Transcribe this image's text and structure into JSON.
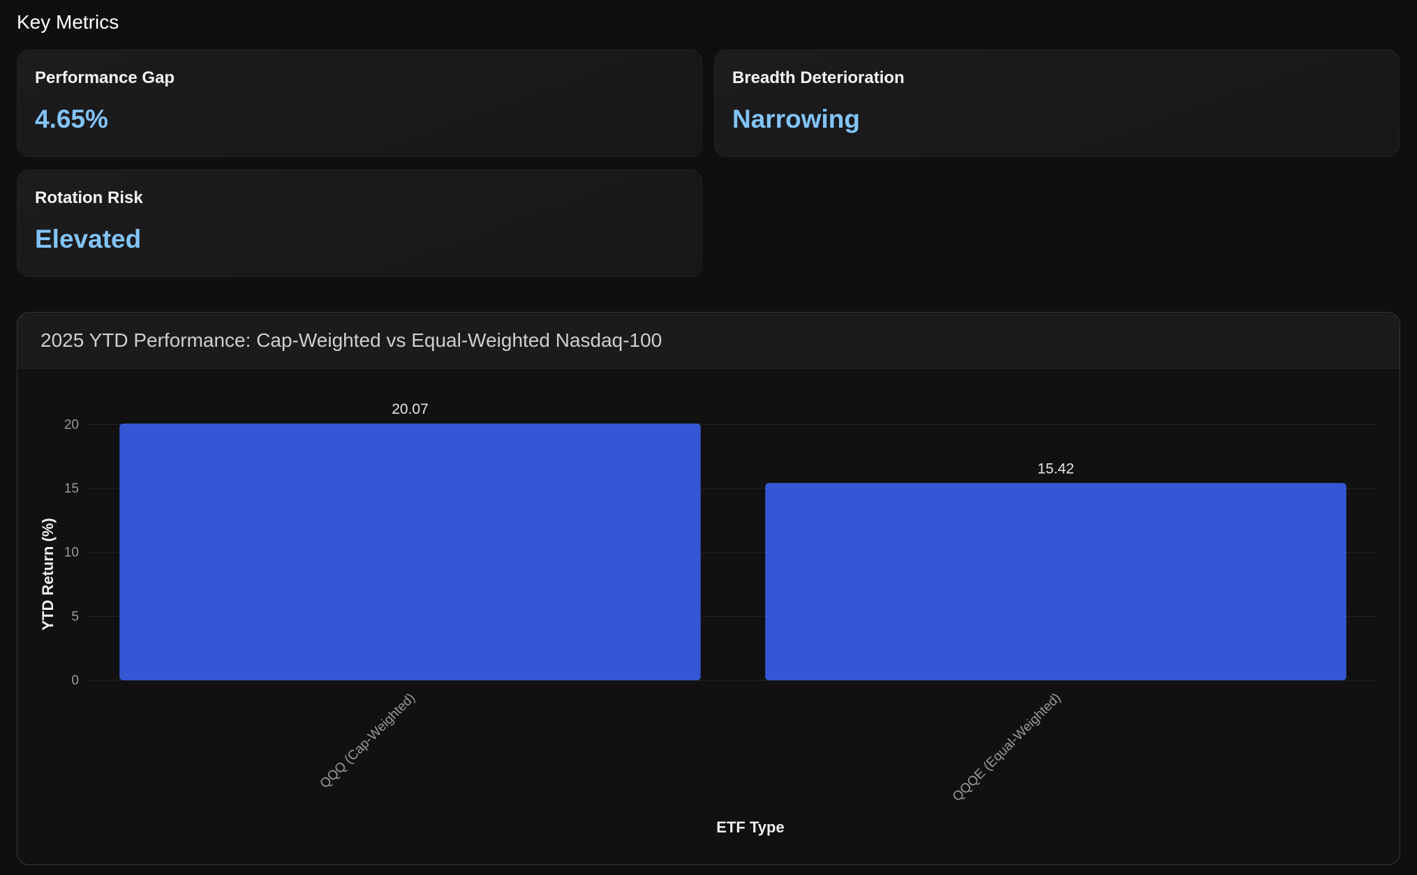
{
  "key_metrics": {
    "title": "Key Metrics",
    "cards": [
      {
        "label": "Performance Gap",
        "value": "4.65%"
      },
      {
        "label": "Breadth Deterioration",
        "value": "Narrowing"
      },
      {
        "label": "Rotation Risk",
        "value": "Elevated"
      }
    ]
  },
  "colors": {
    "accent_value": "#82c4f8",
    "bar": "#3457d5",
    "background": "#0f0f0f"
  },
  "chart_data": {
    "type": "bar",
    "title": "2025 YTD Performance: Cap-Weighted vs Equal-Weighted Nasdaq-100",
    "categories": [
      "QQQ (Cap-Weighted)",
      "QQQE (Equal-Weighted)"
    ],
    "values": [
      20.07,
      15.42
    ],
    "value_labels": [
      "20.07",
      "15.42"
    ],
    "xlabel": "ETF Type",
    "ylabel": "YTD Return (%)",
    "ylim": [
      0,
      20.07
    ],
    "yticks": [
      0,
      5,
      10,
      15,
      20
    ],
    "grid": true
  }
}
